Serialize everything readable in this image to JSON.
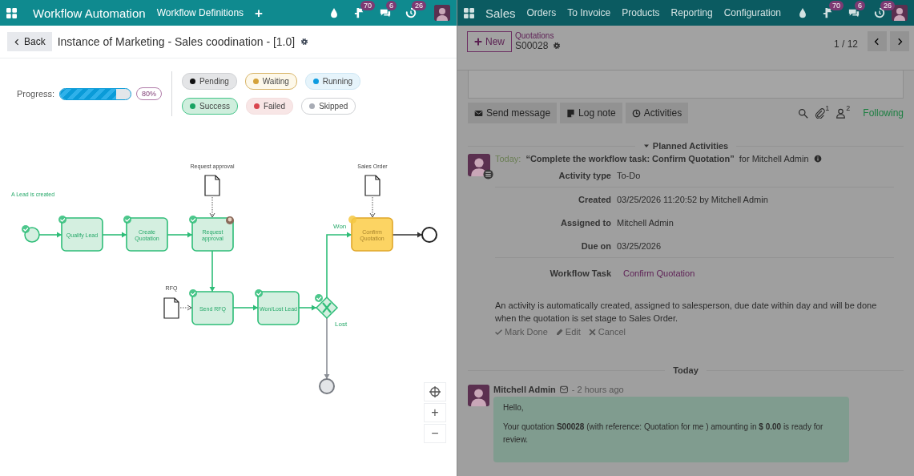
{
  "workflow_app": {
    "navbar": {
      "app_name": "Workflow Automation",
      "menu": [
        "Workflow Definitions"
      ],
      "add": "+",
      "systray": [
        {
          "kind": "drop"
        },
        {
          "kind": "flag",
          "count": "70"
        },
        {
          "kind": "chat",
          "count": "6"
        },
        {
          "kind": "clock",
          "count": "26"
        }
      ]
    },
    "breadcrumb": {
      "back": "Back",
      "title": "Instance of Marketing - Sales coodination - [1.0]"
    },
    "progress": {
      "label": "Progress:",
      "level": 0.8,
      "reading": "80%"
    },
    "legend": [
      {
        "kind": "pending",
        "label": "Pending",
        "color": "#111111"
      },
      {
        "kind": "waiting",
        "label": "Waiting",
        "color": "#d4a23a"
      },
      {
        "kind": "running",
        "label": "Running",
        "color": "#0d9be0"
      },
      {
        "kind": "success",
        "label": "Success",
        "color": "#19a463"
      },
      {
        "kind": "failed",
        "label": "Failed",
        "color": "#d9464f"
      },
      {
        "kind": "skipped",
        "label": "Skipped",
        "color": "#a8acb5"
      }
    ],
    "diagram": {
      "nodes": [
        {
          "kind": "start",
          "label": "A Lead is created",
          "completed": true,
          "current": false,
          "skipped": false,
          "assigned": false
        },
        {
          "kind": "task",
          "label": "Qualify Lead",
          "completed": true,
          "current": false,
          "skipped": false,
          "assigned": false
        },
        {
          "kind": "task",
          "label": "Create Quotation",
          "completed": true,
          "current": false,
          "skipped": false,
          "assigned": false
        },
        {
          "kind": "task",
          "label": "Request approval",
          "completed": true,
          "current": false,
          "skipped": false,
          "assigned": true
        },
        {
          "kind": "task",
          "label": "Send RFQ",
          "completed": true,
          "current": false,
          "skipped": false,
          "assigned": false
        },
        {
          "kind": "task",
          "label": "Won/Lost Lead",
          "completed": true,
          "current": false,
          "skipped": false,
          "assigned": false
        },
        {
          "kind": "gateway",
          "completed": true,
          "current": false,
          "skipped": false,
          "assigned": false
        },
        {
          "kind": "task",
          "label": "Confirm Quotation",
          "completed": false,
          "current": true,
          "skipped": false,
          "assigned": false
        },
        {
          "kind": "end",
          "completed": false,
          "current": false,
          "skipped": false,
          "assigned": false
        },
        {
          "kind": "end",
          "completed": false,
          "current": false,
          "skipped": true,
          "assigned": false
        }
      ],
      "documents": [
        {
          "label": "Request approval"
        },
        {
          "label": "Sales Order"
        },
        {
          "label": "RFQ"
        }
      ],
      "flow_labels": [
        "Won",
        "Lost"
      ],
      "zoom_controls": [
        "+",
        "−"
      ]
    }
  },
  "sales_app": {
    "navbar": {
      "app_name": "Sales",
      "menu": [
        "Orders",
        "To Invoice",
        "Products",
        "Reporting",
        "Configuration"
      ],
      "systray": [
        {
          "kind": "drop"
        },
        {
          "kind": "flag",
          "count": "70"
        },
        {
          "kind": "chat",
          "count": "6"
        },
        {
          "kind": "clock",
          "count": "26"
        }
      ]
    },
    "control_panel": {
      "new": "New",
      "breadcrumb": "Quotations",
      "record": "S00028",
      "pager": "1 / 12"
    },
    "chatter": {
      "buttons": [
        {
          "kind": "message",
          "label": "Send message"
        },
        {
          "kind": "note",
          "label": "Log note"
        },
        {
          "kind": "activities",
          "label": "Activities"
        }
      ],
      "attachments": "1",
      "followers": "2",
      "follow_state": "Following",
      "planned_heading": "Planned Activities",
      "activity": {
        "when": "Today:",
        "summary": "“Complete the workflow task: Confirm Quotation”",
        "assignee": "for Mitchell Admin",
        "details": [
          {
            "label": "Activity type",
            "value": "To-Do"
          },
          {
            "label": "Created",
            "value": "03/25/2026 11:20:52 by Mitchell Admin"
          },
          {
            "label": "Assigned to",
            "value": "Mitchell Admin"
          },
          {
            "label": "Due on",
            "value": "03/25/2026"
          }
        ],
        "task": {
          "label": "Workflow Task",
          "value": "Confirm Quotation"
        },
        "note": "An activity is automatically created, assigned to salesperson, due date within day and will be done when the quotation is set stage to Sales Order.",
        "actions": [
          {
            "kind": "done",
            "label": "Mark Done"
          },
          {
            "kind": "edit",
            "label": "Edit"
          },
          {
            "kind": "cancel",
            "label": "Cancel"
          }
        ]
      },
      "date_divider": "Today",
      "message": {
        "author": "Mitchell Admin",
        "time": "- 2 hours ago",
        "paragraphs": [
          "Hello,",
          "Your quotation **S00028** (with reference: Quotation for me ) amounting in **$ 0.00** is ready for review."
        ]
      }
    }
  }
}
